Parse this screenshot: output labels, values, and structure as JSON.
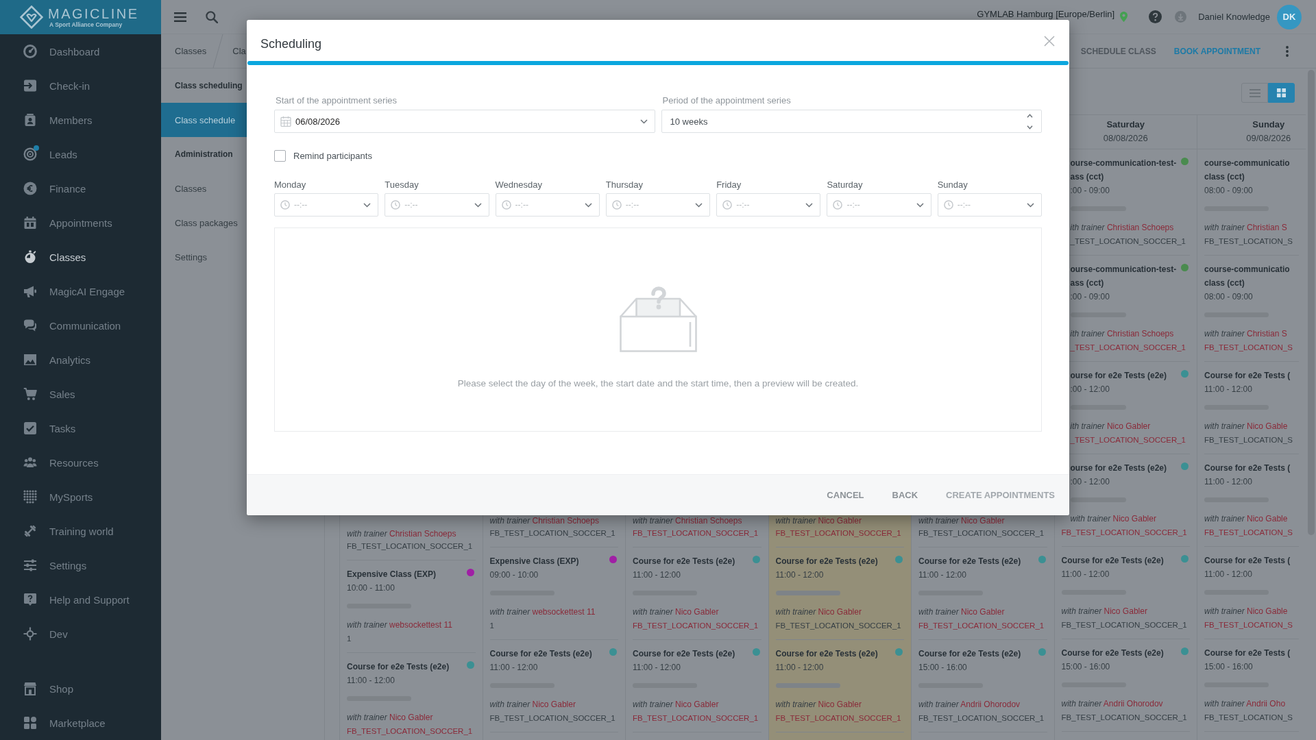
{
  "brand": {
    "name": "MAGICLINE",
    "tagline": "A Sport Alliance Company"
  },
  "sidebar": {
    "items": [
      {
        "label": "Dashboard",
        "selected": false,
        "notification": false
      },
      {
        "label": "Check-in",
        "selected": false,
        "notification": false
      },
      {
        "label": "Members",
        "selected": false,
        "notification": false
      },
      {
        "label": "Leads",
        "selected": false,
        "notification": true
      },
      {
        "label": "Finance",
        "selected": false,
        "notification": false
      },
      {
        "label": "Appointments",
        "selected": false,
        "notification": false
      },
      {
        "label": "Classes",
        "selected": true,
        "notification": false
      },
      {
        "label": "MagicAI Engage",
        "selected": false,
        "notification": false
      },
      {
        "label": "Communication",
        "selected": false,
        "notification": false
      },
      {
        "label": "Analytics",
        "selected": false,
        "notification": false
      },
      {
        "label": "Sales",
        "selected": false,
        "notification": false
      },
      {
        "label": "Tasks",
        "selected": false,
        "notification": false
      },
      {
        "label": "Resources",
        "selected": false,
        "notification": false
      },
      {
        "label": "MySports",
        "selected": false,
        "notification": false
      },
      {
        "label": "Training world",
        "selected": false,
        "notification": false
      },
      {
        "label": "Settings",
        "selected": false,
        "notification": false
      },
      {
        "label": "Help and Support",
        "selected": false,
        "notification": false
      },
      {
        "label": "Dev",
        "selected": false,
        "notification": false
      }
    ],
    "bottom_items": [
      {
        "label": "Shop",
        "selected": false,
        "notification": false
      },
      {
        "label": "Marketplace",
        "selected": false,
        "notification": false
      }
    ]
  },
  "topbar": {
    "location": "GYMLAB Hamburg [Europe/Berlin]",
    "user_name": "Daniel Knowledge",
    "avatar_initials": "DK"
  },
  "subbar": {
    "breadcrumbs": [
      "Classes",
      "Cla"
    ],
    "actions": [
      {
        "label": "SCHEDULE CLASS",
        "disabled": true
      },
      {
        "label": "BOOK APPOINTMENT",
        "disabled": false
      }
    ]
  },
  "subnav": {
    "sections": [
      {
        "heading": "Class scheduling",
        "items": [
          {
            "label": "Class schedule",
            "selected": true
          }
        ]
      },
      {
        "heading": "Administration",
        "items": [
          {
            "label": "Classes",
            "selected": false
          },
          {
            "label": "Class packages",
            "selected": false
          },
          {
            "label": "Settings",
            "selected": false
          }
        ]
      }
    ]
  },
  "view_toggle": [
    {
      "selected": false
    },
    {
      "selected": true
    }
  ],
  "calendar": {
    "days": [
      {
        "today": false,
        "events": [
          {
            "trainer_label": "with trainer",
            "trainer": "Christian Schoeps",
            "location": "FB_TEST_LOCATION_SOCCER_1",
            "location_highlighted": false
          },
          {
            "title_lines": [
              "Expensive Class (EXP)"
            ],
            "time": "10:00 - 11:00",
            "color": "#a01fa5",
            "trainer_label": "with trainer",
            "trainer": "websockettest 11",
            "location": "1",
            "location_highlighted": false
          },
          {
            "title_lines": [
              "Course for e2e Tests (e2e)"
            ],
            "time": "11:00 - 12:00",
            "color": "#3b9093",
            "trainer_label": "with trainer",
            "trainer": "Nico Gabler",
            "location": "FB_TEST_LOCATION_SOCCER_1",
            "location_highlighted": true
          }
        ]
      },
      {
        "today": false,
        "events": [
          {
            "trainer_label": "with trainer",
            "trainer": "Christian Schoeps",
            "location": "FB_TEST_LOCATION_SOCCER_1",
            "location_highlighted": false
          },
          {
            "title_lines": [
              "Expensive Class (EXP)"
            ],
            "time": "09:00 - 10:00",
            "color": "#a01fa5",
            "trainer_label": "with trainer",
            "trainer": "websockettest 11",
            "location": "1",
            "location_highlighted": false
          },
          {
            "title_lines": [
              "Course for e2e Tests (e2e)"
            ],
            "time": "11:00 - 12:00",
            "color": "#3b9093",
            "trainer_label": "with trainer",
            "trainer": "Nico Gabler",
            "location": "FB_TEST_LOCATION_SOCCER_1",
            "location_highlighted": false
          }
        ]
      },
      {
        "today": false,
        "events": [
          {
            "trainer_label": "with trainer",
            "trainer": "Christian Schoeps",
            "location": "FB_TEST_LOCATION_SOCCER_1",
            "location_highlighted": true
          },
          {
            "title_lines": [
              "Course for e2e Tests (e2e)"
            ],
            "time": "11:00 - 12:00",
            "color": "#3b9093",
            "trainer_label": "with trainer",
            "trainer": "Nico Gabler",
            "location": "FB_TEST_LOCATION_SOCCER_1",
            "location_highlighted": true
          },
          {
            "title_lines": [
              "Course for e2e Tests (e2e)"
            ],
            "time": "11:00 - 12:00",
            "color": "#3b9093",
            "trainer_label": "with trainer",
            "trainer": "Nico Gabler",
            "location": "FB_TEST_LOCATION_SOCCER_1",
            "location_highlighted": true
          }
        ]
      },
      {
        "today": true,
        "events": [
          {
            "trainer_label": "with trainer",
            "trainer": "Nico Gabler",
            "location": "FB_TEST_LOCATION_SOCCER_1",
            "location_highlighted": true
          },
          {
            "title_lines": [
              "Course for e2e Tests (e2e)"
            ],
            "time": "11:00 - 12:00",
            "color": "#3b9093",
            "trainer_label": "with trainer",
            "trainer": "Nico Gabler",
            "location": "FB_TEST_LOCATION_SOCCER_1",
            "location_highlighted": false
          },
          {
            "title_lines": [
              "Course for e2e Tests (e2e)"
            ],
            "time": "11:00 - 12:00",
            "color": "#3b9093",
            "trainer_label": "with trainer",
            "trainer": "Nico Gabler",
            "location": "FB_TEST_LOCATION_SOCCER_1",
            "location_highlighted": true
          }
        ]
      },
      {
        "today": false,
        "events": [
          {
            "trainer_label": "with trainer",
            "trainer": "Nico Gabler",
            "location": "FB_TEST_LOCATION_SOCCER_1",
            "location_highlighted": false
          },
          {
            "title_lines": [
              "Course for e2e Tests (e2e)"
            ],
            "time": "11:00 - 12:00",
            "color": "#3b9093",
            "trainer_label": "with trainer",
            "trainer": "Nico Gabler",
            "location": "FB_TEST_LOCATION_SOCCER_1",
            "location_highlighted": true
          },
          {
            "title_lines": [
              "Course for e2e Tests (e2e)"
            ],
            "time": "15:00 - 16:00",
            "color": "#3b9093",
            "trainer_label": "with trainer",
            "trainer": "Andrii Ohorodov",
            "location": "FB_TEST_LOCATION_SOCCER_1",
            "location_highlighted": false
          }
        ]
      },
      {
        "day": "Saturday",
        "date": "08/08/2026",
        "today": false,
        "events": [
          {
            "title_lines": [
              "ourse-communication-test-",
              "ass (cct)"
            ],
            "time": ":00 - 09:00",
            "color": "#4a8b4f",
            "trainer_label": "ith trainer",
            "trainer": "Christian Schoeps",
            "location": "_TEST_LOCATION_SOCCER_1",
            "location_highlighted": false
          },
          {
            "title_lines": [
              "ourse-communication-test-",
              "ass (cct)"
            ],
            "time": ":00 - 09:00",
            "color": "#4a8b4f",
            "trainer_label": "ith trainer",
            "trainer": "Christian Schoeps",
            "location": "_TEST_LOCATION_SOCCER_1",
            "location_highlighted": true
          },
          {
            "title_lines": [
              "ourse for e2e Tests (e2e)"
            ],
            "time": ":00 - 12:00",
            "color": "#3b9093",
            "trainer_label": "ith trainer",
            "trainer": "Nico Gabler",
            "location": "_TEST_LOCATION_SOCCER_1",
            "location_highlighted": true
          },
          {
            "title_lines": [
              "ourse for e2e Tests (e2e)"
            ],
            "time": ":00 - 12:00",
            "color": "#3b9093",
            "trainer_label": "with trainer",
            "trainer": "Nico Gabler",
            "location": "FB_TEST_LOCATION_SOCCER_1",
            "location_highlighted": true
          },
          {
            "title_lines": [
              "Course for e2e Tests (e2e)"
            ],
            "time": "11:00 - 12:00",
            "color": "#3b9093",
            "trainer_label": "with trainer",
            "trainer": "Nico Gabler",
            "location": "FB_TEST_LOCATION_SOCCER_1",
            "location_highlighted": false
          },
          {
            "title_lines": [
              "Course for e2e Tests (e2e)"
            ],
            "time": "15:00 - 16:00",
            "color": "#3b9093",
            "trainer_label": "with trainer",
            "trainer": "Andrii Ohorodov",
            "location": "FB_TEST_LOCATION_SOCCER_1",
            "location_highlighted": false
          }
        ]
      },
      {
        "day": "Sunday",
        "date": "09/08/2026",
        "today": false,
        "events": [
          {
            "title_lines": [
              "course-communicatio",
              "class (cct)"
            ],
            "time": "08:00 - 09:00",
            "trainer_label": "with trainer",
            "trainer": "Christian S",
            "location": "FB_TEST_LOCATION_S",
            "location_highlighted": false
          },
          {
            "title_lines": [
              "course-communicatio",
              "class (cct)"
            ],
            "time": "08:00 - 09:00",
            "trainer_label": "with trainer",
            "trainer": "Christian S",
            "location": "FB_TEST_LOCATION_S",
            "location_highlighted": true
          },
          {
            "title_lines": [
              "Course for e2e Tests ("
            ],
            "time": "11:00 - 12:00",
            "trainer_label": "with trainer",
            "trainer": "Nico Gable",
            "location": "FB_TEST_LOCATION_S",
            "location_highlighted": false
          },
          {
            "title_lines": [
              "Course for e2e Tests ("
            ],
            "time": "11:00 - 12:00",
            "trainer_label": "with trainer",
            "trainer": "Nico Gable",
            "location": "FB_TEST_LOCATION_S",
            "location_highlighted": true
          },
          {
            "title_lines": [
              "Course for e2e Tests ("
            ],
            "time": "11:00 - 12:00",
            "trainer_label": "with trainer",
            "trainer": "Nico Gable",
            "location": "FB_TEST_LOCATION_S",
            "location_highlighted": true
          },
          {
            "title_lines": [
              "Course for e2e Tests ("
            ],
            "time": "15:00 - 16:00",
            "trainer_label": "with trainer",
            "trainer": "Andrii Oho",
            "location": "FB_TEST_LOCATION_S",
            "location_highlighted": false
          }
        ]
      }
    ]
  },
  "dialog": {
    "title": "Scheduling",
    "start_date": {
      "label": "Start of the appointment series",
      "value": "06/08/2026"
    },
    "period": {
      "label": "Period of the appointment series",
      "value": "10 weeks"
    },
    "remind_participants": {
      "label": "Remind participants",
      "checked": false
    },
    "weekdays": [
      {
        "label": "Monday",
        "placeholder": "--:--"
      },
      {
        "label": "Tuesday",
        "placeholder": "--:--"
      },
      {
        "label": "Wednesday",
        "placeholder": "--:--"
      },
      {
        "label": "Thursday",
        "placeholder": "--:--"
      },
      {
        "label": "Friday",
        "placeholder": "--:--"
      },
      {
        "label": "Saturday",
        "placeholder": "--:--"
      },
      {
        "label": "Sunday",
        "placeholder": "--:--"
      }
    ],
    "empty_message": "Please select the day of the week, the start date and the start time, then a preview will be created.",
    "buttons": [
      {
        "label": "CANCEL",
        "disabled": false
      },
      {
        "label": "BACK",
        "disabled": false
      },
      {
        "label": "CREATE APPOINTMENTS",
        "disabled": true
      }
    ]
  }
}
